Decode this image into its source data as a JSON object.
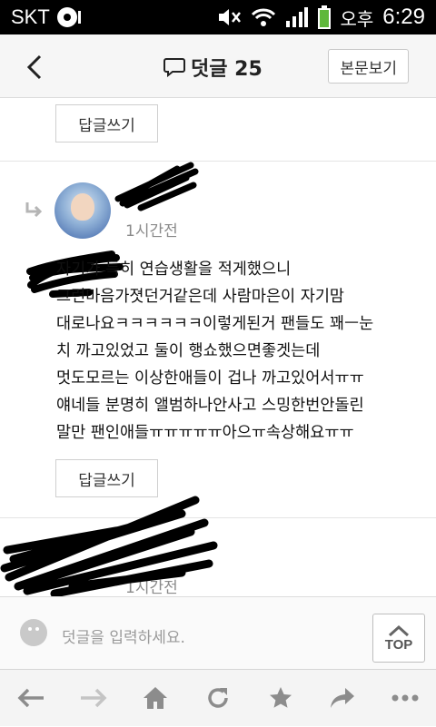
{
  "status_bar": {
    "carrier": "SKT",
    "ampm": "오후",
    "time": "6:29"
  },
  "header": {
    "back_icon": "chevron-left-icon",
    "comment_icon": "speech-bubble-icon",
    "title": "덧글 25",
    "view_article_label": "본문보기"
  },
  "comments": [
    {
      "reply_label": "답글쓰기"
    },
    {
      "time": "1시간전",
      "text": "자기가 특히 연습생활을 적게했으니\n그런마음가졋던거같은데 사람마은이 자기맘\n대로나요ㅋㅋㅋㅋㅋㅋ이렇게된거 팬들도 꽤ㅡ눈\n치 까고있었고 둘이 행쇼했으면좋겟는데\n멋도모르는 이상한애들이 겁나 까고있어서ㅠㅠ\n얘네들 분명히 앨범하나안사고 스밍한번안돌린\n말만 팬인애들ㅠㅠㅠㅠㅠ아으ㅠ속상해요ㅠㅠ",
      "reply_label": "답글쓰기"
    },
    {
      "time": "1시간전"
    }
  ],
  "input_bar": {
    "placeholder": "덧글을 입력하세요.",
    "top_label": "TOP"
  },
  "toolbar": {
    "icons": [
      "back-arrow-icon",
      "forward-arrow-icon",
      "home-icon",
      "refresh-icon",
      "star-icon",
      "share-icon",
      "more-icon"
    ]
  },
  "colors": {
    "scribble": "#000000",
    "muted_text": "#8a8a8a",
    "icon_gray": "#8c8c8c"
  }
}
